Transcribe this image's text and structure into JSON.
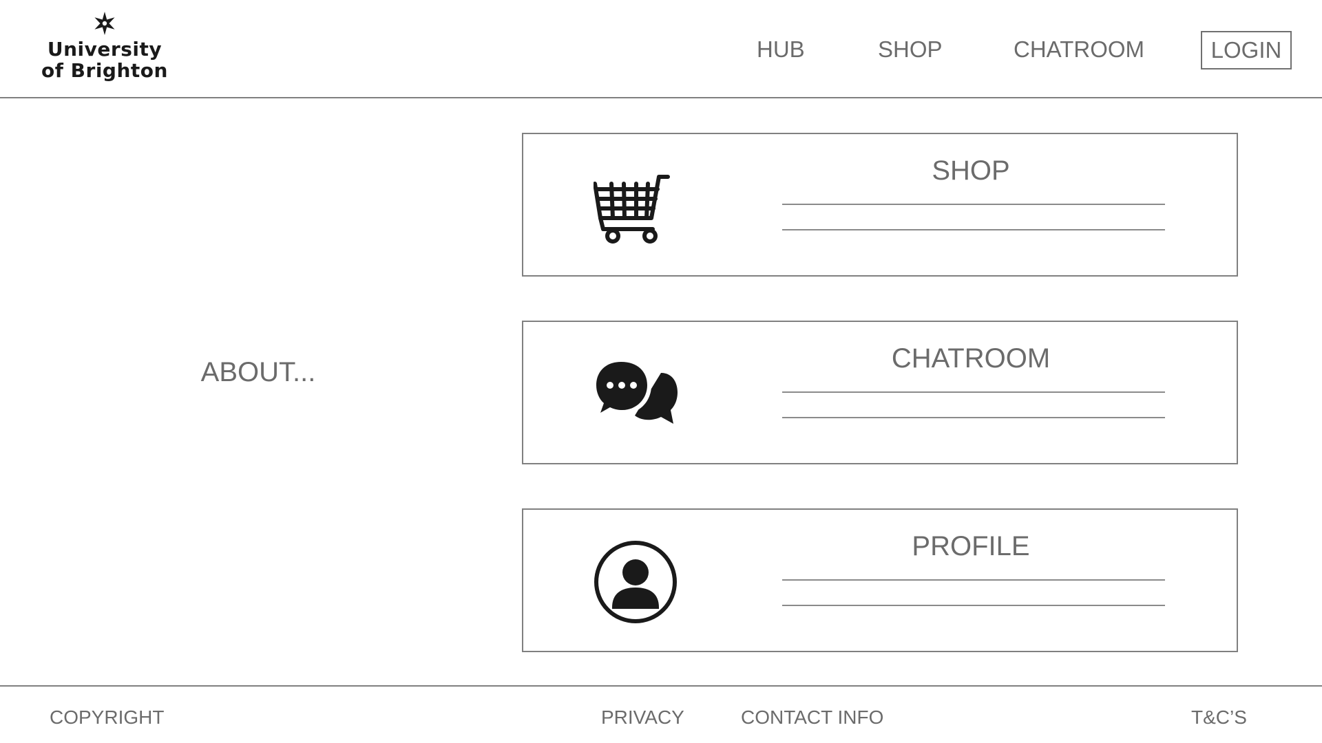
{
  "header": {
    "logo": {
      "line1": "University",
      "line2": "of Brighton",
      "icon": "star-emblem-icon"
    },
    "nav": {
      "hub": "HUB",
      "shop": "SHOP",
      "chatroom": "CHATROOM",
      "login": "LOGIN"
    }
  },
  "main": {
    "about": "ABOUT...",
    "cards": [
      {
        "title": "SHOP",
        "icon": "shopping-cart-icon"
      },
      {
        "title": "CHATROOM",
        "icon": "chat-bubbles-icon"
      },
      {
        "title": "PROFILE",
        "icon": "user-profile-icon"
      }
    ]
  },
  "footer": {
    "copyright": "COPYRIGHT",
    "privacy": "PRIVACY",
    "contact": "CONTACT INFO",
    "terms": "T&C’S"
  },
  "colors": {
    "text": "#6b6b6b",
    "border": "#808080",
    "icon": "#1a1a1a",
    "background": "#ffffff"
  }
}
